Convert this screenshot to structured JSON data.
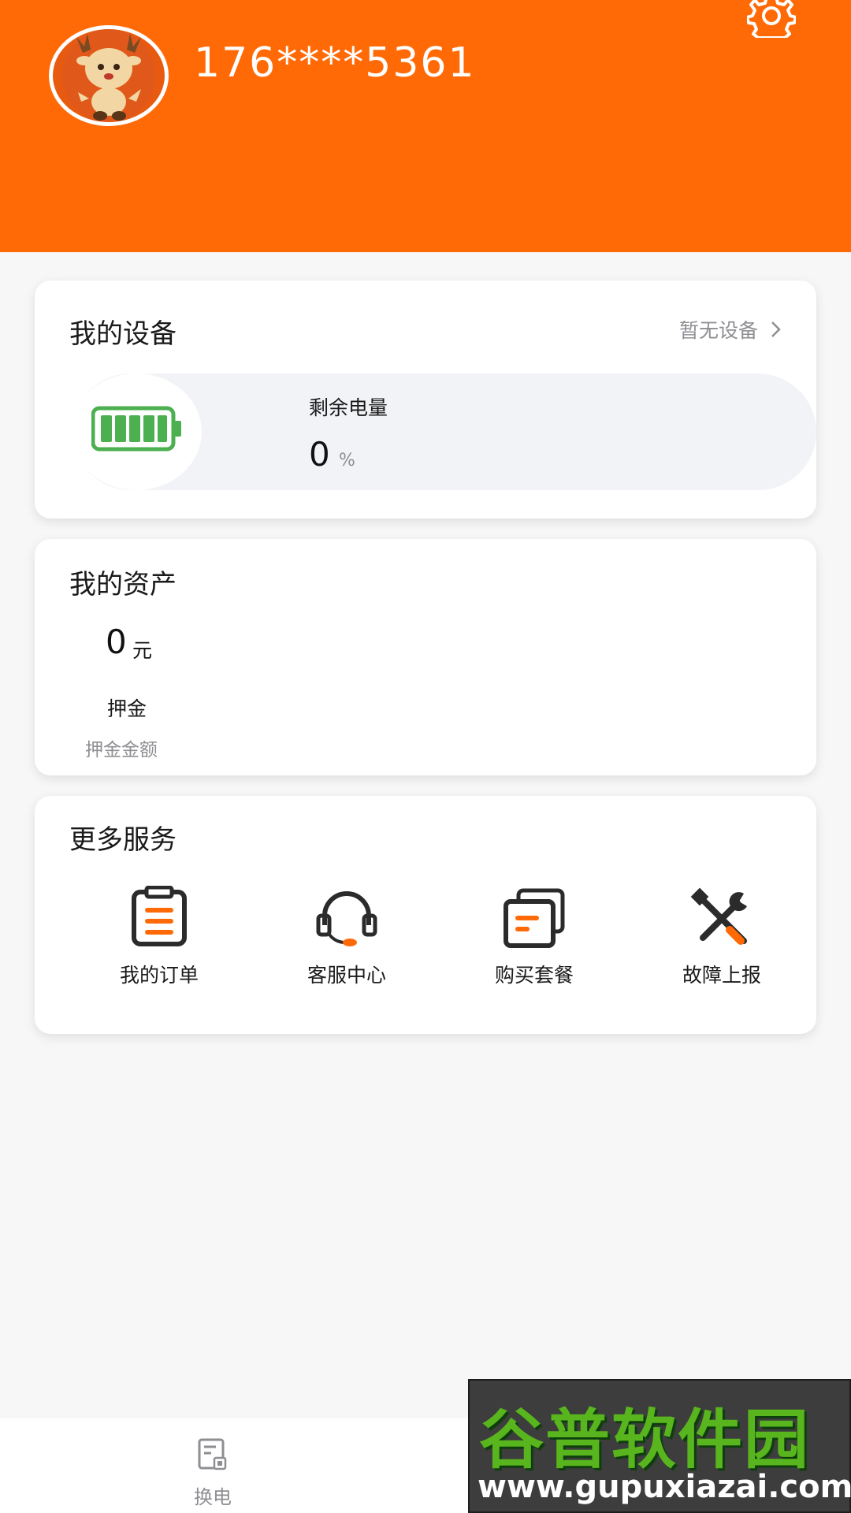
{
  "header": {
    "phone": "176****5361",
    "accent_color": "#ff6a06",
    "settings_icon": "gear-icon",
    "avatar_icon": "deer-mascot-avatar"
  },
  "device": {
    "title": "我的设备",
    "link_label": "暂无设备",
    "link_icon": "chevron-right-icon",
    "battery_icon": "battery-icon",
    "remaining_label": "剩余电量",
    "remaining_value": "0",
    "remaining_unit": "%"
  },
  "assets": {
    "title": "我的资产",
    "value": "0",
    "unit": "元",
    "label": "押金",
    "sublabel": "押金金额"
  },
  "services": {
    "title": "更多服务",
    "items": [
      {
        "label": "我的订单",
        "icon": "order-list-icon"
      },
      {
        "label": "客服中心",
        "icon": "headset-icon"
      },
      {
        "label": "购买套餐",
        "icon": "package-icon"
      },
      {
        "label": "故障上报",
        "icon": "tools-icon"
      }
    ]
  },
  "tabbar": {
    "tabs": [
      {
        "label": "换电",
        "icon": "swap-battery-icon"
      }
    ]
  },
  "watermark": {
    "site_name": "谷普软件园",
    "url": "www.gupuxiazai.com"
  }
}
